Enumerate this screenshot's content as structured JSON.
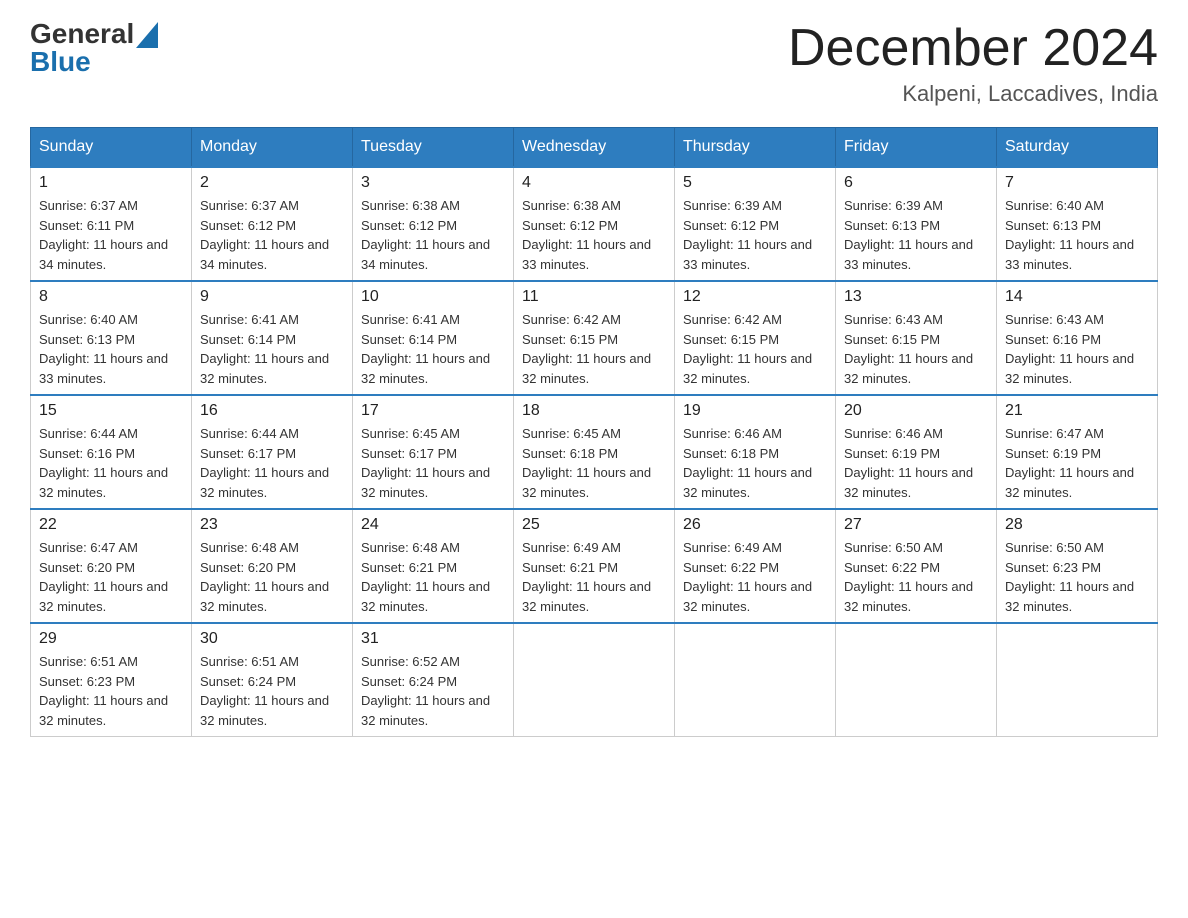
{
  "logo": {
    "general": "General",
    "blue": "Blue"
  },
  "title": "December 2024",
  "location": "Kalpeni, Laccadives, India",
  "days_of_week": [
    "Sunday",
    "Monday",
    "Tuesday",
    "Wednesday",
    "Thursday",
    "Friday",
    "Saturday"
  ],
  "weeks": [
    [
      {
        "day": "1",
        "sunrise": "6:37 AM",
        "sunset": "6:11 PM",
        "daylight": "11 hours and 34 minutes."
      },
      {
        "day": "2",
        "sunrise": "6:37 AM",
        "sunset": "6:12 PM",
        "daylight": "11 hours and 34 minutes."
      },
      {
        "day": "3",
        "sunrise": "6:38 AM",
        "sunset": "6:12 PM",
        "daylight": "11 hours and 34 minutes."
      },
      {
        "day": "4",
        "sunrise": "6:38 AM",
        "sunset": "6:12 PM",
        "daylight": "11 hours and 33 minutes."
      },
      {
        "day": "5",
        "sunrise": "6:39 AM",
        "sunset": "6:12 PM",
        "daylight": "11 hours and 33 minutes."
      },
      {
        "day": "6",
        "sunrise": "6:39 AM",
        "sunset": "6:13 PM",
        "daylight": "11 hours and 33 minutes."
      },
      {
        "day": "7",
        "sunrise": "6:40 AM",
        "sunset": "6:13 PM",
        "daylight": "11 hours and 33 minutes."
      }
    ],
    [
      {
        "day": "8",
        "sunrise": "6:40 AM",
        "sunset": "6:13 PM",
        "daylight": "11 hours and 33 minutes."
      },
      {
        "day": "9",
        "sunrise": "6:41 AM",
        "sunset": "6:14 PM",
        "daylight": "11 hours and 32 minutes."
      },
      {
        "day": "10",
        "sunrise": "6:41 AM",
        "sunset": "6:14 PM",
        "daylight": "11 hours and 32 minutes."
      },
      {
        "day": "11",
        "sunrise": "6:42 AM",
        "sunset": "6:15 PM",
        "daylight": "11 hours and 32 minutes."
      },
      {
        "day": "12",
        "sunrise": "6:42 AM",
        "sunset": "6:15 PM",
        "daylight": "11 hours and 32 minutes."
      },
      {
        "day": "13",
        "sunrise": "6:43 AM",
        "sunset": "6:15 PM",
        "daylight": "11 hours and 32 minutes."
      },
      {
        "day": "14",
        "sunrise": "6:43 AM",
        "sunset": "6:16 PM",
        "daylight": "11 hours and 32 minutes."
      }
    ],
    [
      {
        "day": "15",
        "sunrise": "6:44 AM",
        "sunset": "6:16 PM",
        "daylight": "11 hours and 32 minutes."
      },
      {
        "day": "16",
        "sunrise": "6:44 AM",
        "sunset": "6:17 PM",
        "daylight": "11 hours and 32 minutes."
      },
      {
        "day": "17",
        "sunrise": "6:45 AM",
        "sunset": "6:17 PM",
        "daylight": "11 hours and 32 minutes."
      },
      {
        "day": "18",
        "sunrise": "6:45 AM",
        "sunset": "6:18 PM",
        "daylight": "11 hours and 32 minutes."
      },
      {
        "day": "19",
        "sunrise": "6:46 AM",
        "sunset": "6:18 PM",
        "daylight": "11 hours and 32 minutes."
      },
      {
        "day": "20",
        "sunrise": "6:46 AM",
        "sunset": "6:19 PM",
        "daylight": "11 hours and 32 minutes."
      },
      {
        "day": "21",
        "sunrise": "6:47 AM",
        "sunset": "6:19 PM",
        "daylight": "11 hours and 32 minutes."
      }
    ],
    [
      {
        "day": "22",
        "sunrise": "6:47 AM",
        "sunset": "6:20 PM",
        "daylight": "11 hours and 32 minutes."
      },
      {
        "day": "23",
        "sunrise": "6:48 AM",
        "sunset": "6:20 PM",
        "daylight": "11 hours and 32 minutes."
      },
      {
        "day": "24",
        "sunrise": "6:48 AM",
        "sunset": "6:21 PM",
        "daylight": "11 hours and 32 minutes."
      },
      {
        "day": "25",
        "sunrise": "6:49 AM",
        "sunset": "6:21 PM",
        "daylight": "11 hours and 32 minutes."
      },
      {
        "day": "26",
        "sunrise": "6:49 AM",
        "sunset": "6:22 PM",
        "daylight": "11 hours and 32 minutes."
      },
      {
        "day": "27",
        "sunrise": "6:50 AM",
        "sunset": "6:22 PM",
        "daylight": "11 hours and 32 minutes."
      },
      {
        "day": "28",
        "sunrise": "6:50 AM",
        "sunset": "6:23 PM",
        "daylight": "11 hours and 32 minutes."
      }
    ],
    [
      {
        "day": "29",
        "sunrise": "6:51 AM",
        "sunset": "6:23 PM",
        "daylight": "11 hours and 32 minutes."
      },
      {
        "day": "30",
        "sunrise": "6:51 AM",
        "sunset": "6:24 PM",
        "daylight": "11 hours and 32 minutes."
      },
      {
        "day": "31",
        "sunrise": "6:52 AM",
        "sunset": "6:24 PM",
        "daylight": "11 hours and 32 minutes."
      },
      null,
      null,
      null,
      null
    ]
  ]
}
